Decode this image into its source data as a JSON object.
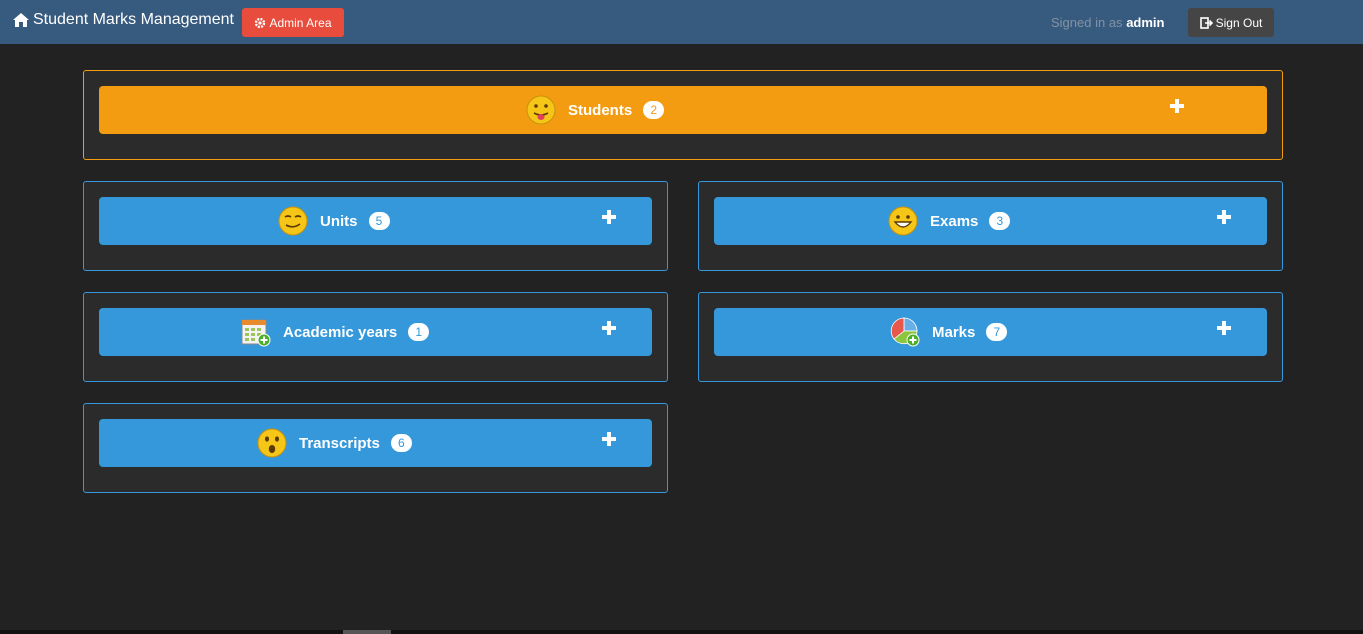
{
  "navbar": {
    "brand": "Student Marks Management",
    "admin_label": "Admin Area",
    "signed_prefix": "Signed in as",
    "username": "admin",
    "signout_label": "Sign Out"
  },
  "cards": {
    "students": {
      "label": "Students",
      "count": "2"
    },
    "units": {
      "label": "Units",
      "count": "5"
    },
    "exams": {
      "label": "Exams",
      "count": "3"
    },
    "academic_years": {
      "label": "Academic years",
      "count": "1"
    },
    "marks": {
      "label": "Marks",
      "count": "7"
    },
    "transcripts": {
      "label": "Transcripts",
      "count": "6"
    }
  },
  "colors": {
    "navbar": "#375a7f",
    "primary": "#3498db",
    "warning": "#f39c12",
    "danger": "#e74c3c",
    "background": "#222222"
  },
  "icons": {
    "home": "home-icon",
    "admin": "gear-icon",
    "signout": "sign-out-icon",
    "add": "plus-icon"
  }
}
